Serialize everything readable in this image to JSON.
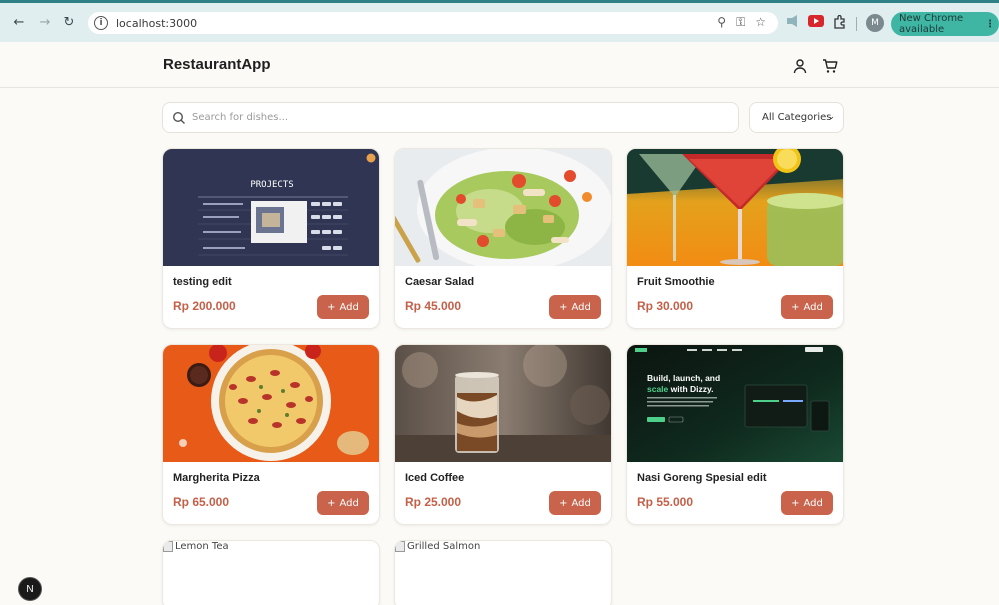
{
  "browser": {
    "url": "localhost:3000",
    "update_label": "New Chrome available",
    "profile_initial": "M"
  },
  "app": {
    "brand": "RestaurantApp",
    "search_placeholder": "Search for dishes...",
    "category_selected": "All Categories",
    "add_label": "Add",
    "dev_badge": "N"
  },
  "items": [
    {
      "name": "testing edit",
      "price": "Rp 200.000"
    },
    {
      "name": "Caesar Salad",
      "price": "Rp 45.000"
    },
    {
      "name": "Fruit Smoothie",
      "price": "Rp 30.000"
    },
    {
      "name": "Margherita Pizza",
      "price": "Rp 65.000"
    },
    {
      "name": "Iced Coffee",
      "price": "Rp 25.000"
    },
    {
      "name": "Nasi Goreng Spesial edit",
      "price": "Rp 55.000"
    }
  ],
  "broken_items": [
    {
      "alt": "Lemon Tea"
    },
    {
      "alt": "Grilled Salmon"
    }
  ],
  "image_text": {
    "projects_title": "PROJECTS",
    "dizzy_line1": "Build, launch, and",
    "dizzy_line2a": "scale",
    "dizzy_line2b": " with Dizzy."
  },
  "colors": {
    "accent": "#c9634b",
    "price": "#c45f48",
    "chrome_bar": "#e1eef0"
  }
}
